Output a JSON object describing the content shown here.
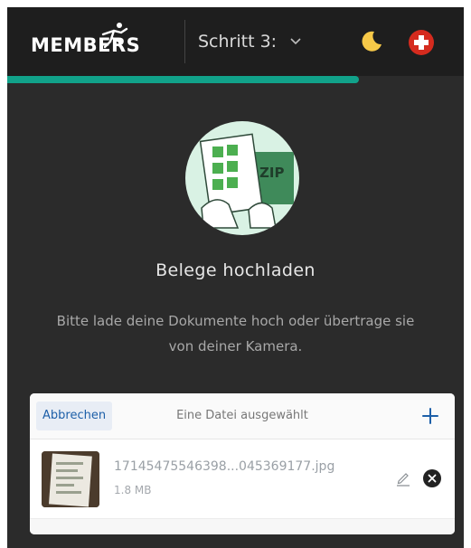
{
  "header": {
    "logo_text": "MEMBERS",
    "step_label": "Schritt 3:",
    "theme_icon": "moon-icon",
    "language_icon": "swiss-flag-icon"
  },
  "progress": {
    "fraction": 0.77,
    "color": "#11a28a"
  },
  "hero": {
    "illustration": "documents-zip-illustration",
    "title": "Belege hochladen",
    "subtitle": "Bitte lade deine Dokumente hoch oder übertrage sie von deiner Kamera."
  },
  "uploader": {
    "cancel_label": "Abbrechen",
    "status": "Eine Datei ausgewählt",
    "add_icon": "plus-icon",
    "files": [
      {
        "name": "17145475546398...045369177.jpg",
        "size": "1.8 MB"
      }
    ]
  },
  "colors": {
    "accent": "#11a28a",
    "background": "#2b2b2b",
    "topbar": "#1e1e1e",
    "link": "#1d5fa8"
  }
}
